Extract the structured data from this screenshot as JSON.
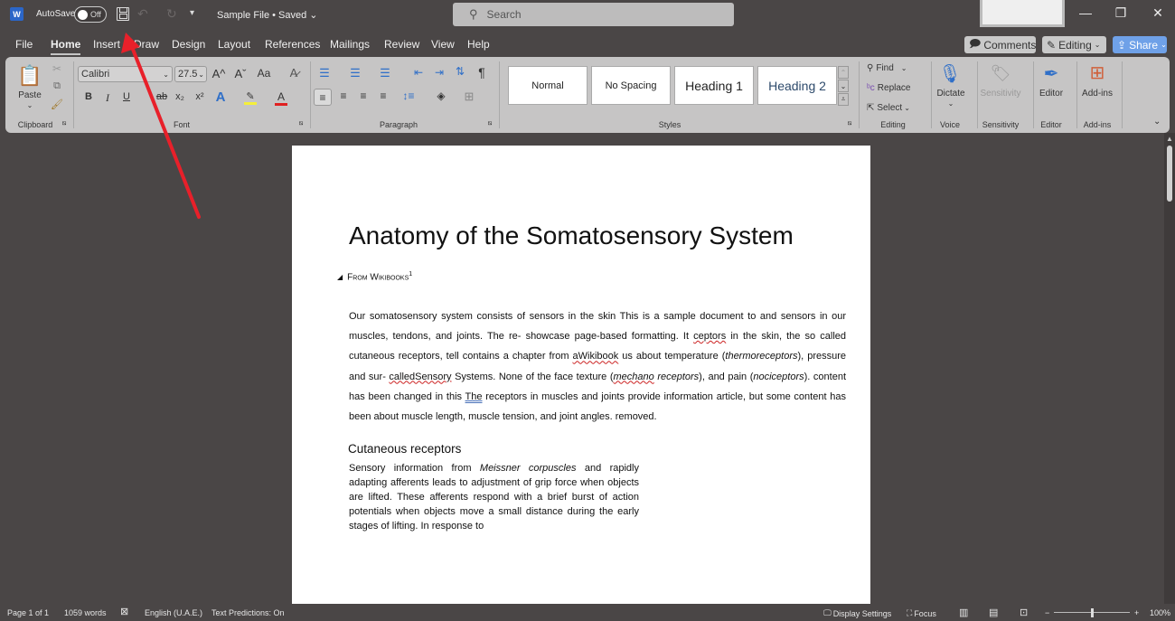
{
  "titlebar": {
    "app_icon": "W",
    "autosave_label": "AutoSave",
    "autosave_state": "Off",
    "qat_more": "▾",
    "document_title": "Sample File • Saved ⌄",
    "search_placeholder": "Search",
    "minimize": "—",
    "restore": "❐",
    "close": "✕"
  },
  "menu": {
    "tabs": [
      "File",
      "Home",
      "Insert",
      "Draw",
      "Design",
      "Layout",
      "References",
      "Mailings",
      "Review",
      "View",
      "Help"
    ],
    "active_tab": "Home",
    "comments_label": "Comments",
    "editing_label": "Editing",
    "share_label": "Share"
  },
  "ribbon": {
    "clipboard": {
      "paste_label": "Paste",
      "group_label": "Clipboard"
    },
    "font": {
      "font_name": "Calibri",
      "font_size": "27.5",
      "group_label": "Font",
      "bold": "B",
      "italic": "I",
      "underline": "U",
      "strike": "ab",
      "subscript": "x₂",
      "superscript": "x²",
      "grow": "A^",
      "shrink": "Aˇ",
      "case": "Aa",
      "highlight_color": "#f5ef3a",
      "font_color": "#e02020"
    },
    "paragraph": {
      "group_label": "Paragraph",
      "pilcrow": "¶"
    },
    "styles": {
      "items": [
        "Normal",
        "No Spacing",
        "Heading 1",
        "Heading 2"
      ],
      "group_label": "Styles"
    },
    "editing": {
      "find": "Find",
      "replace": "Replace",
      "select": "Select",
      "group_label": "Editing"
    },
    "voice": {
      "dictate": "Dictate",
      "group_label": "Voice"
    },
    "sensitivity": {
      "label": "Sensitivity",
      "group_label": "Sensitivity"
    },
    "editor": {
      "label": "Editor",
      "group_label": "Editor"
    },
    "addins": {
      "label": "Add-ins",
      "group_label": "Add-ins"
    }
  },
  "document": {
    "title": "Anatomy of the Somatosensory System",
    "subtitle": "From Wikibooks",
    "subtitle_footnote": "1",
    "para1": {
      "a": "Our somatosensory system consists of sensors in the skin This is a sample document to and sensors in our muscles, tendons, and joints. The re- showcase page-based formatting. It ",
      "b": "ceptors",
      "c": " in the skin, the so called cutaneous receptors, tell contains a chapter from ",
      "d": "aWikibook",
      "e": " us about temperature (",
      "f": "thermoreceptors",
      "g": "), pressure and sur- ",
      "h": "calledSensory",
      "i": " Systems. None of the face texture (",
      "j": "mechano",
      "k": "receptors",
      "l": "), and pain (",
      "m": "nociceptors",
      "n": "). content has been changed in this ",
      "o": "The",
      "p": " receptors in muscles and joints provide information article, but some content has been about muscle length, muscle tension, and joint angles. removed."
    },
    "heading2": "Cutaneous receptors",
    "para2": {
      "a": "Sensory information from ",
      "b": "Meissner corpuscles",
      "c": " and rapidly adapting afferents leads to adjustment of grip force when objects are lifted. These afferents respond with a brief burst of action potentials when objects move a small distance during the early stages of lifting. In response to"
    }
  },
  "statusbar": {
    "page": "Page 1 of 1",
    "words": "1059 words",
    "language": "English (U.A.E.)",
    "text_predictions": "Text Predictions: On",
    "display_settings": "Display Settings",
    "focus": "Focus",
    "zoom_minus": "−",
    "zoom_plus": "+",
    "zoom_level": "100%"
  },
  "annotation": {
    "color": "#e8202a"
  }
}
